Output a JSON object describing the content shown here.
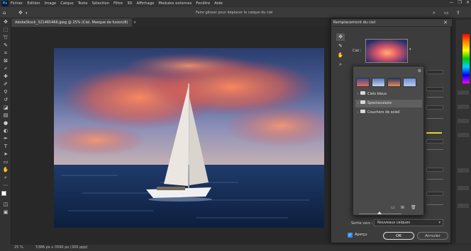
{
  "menubar": {
    "logo": "Ps",
    "items": [
      "Fichier",
      "Edition",
      "Image",
      "Calque",
      "Texte",
      "Sélection",
      "Filtre",
      "3D",
      "Affichage",
      "Modules externes",
      "Fenêtre",
      "Aide"
    ],
    "window_controls": [
      "—",
      "❐",
      "✕"
    ]
  },
  "optionsbar": {
    "hint": "Faire glisser pour déplacer le calque du ciel"
  },
  "document": {
    "tab_label": "AdobeStock_321465466.jpeg @ 25% (Ciel, Masque de fusion/8)",
    "tab_close": "×"
  },
  "statusbar": {
    "zoom": "25 %",
    "info": "5386 px x 3590 px (300 ppp)"
  },
  "dialog": {
    "title": "Remplacement du ciel",
    "close": "✕",
    "sky_label": "Ciel :",
    "dropdown_arrow": "▾",
    "output_label": "Sortie vers :",
    "output_value": "Nouveaux calques",
    "preview_check": "✓",
    "preview_label": "Aperçu",
    "ok_label": "OK",
    "cancel_label": "Annuler"
  },
  "sky_popup": {
    "gear": "⚙",
    "folders": [
      {
        "chevron": "›",
        "label": "Ciels bleus"
      },
      {
        "chevron": "›",
        "label": "Spectaculaire"
      },
      {
        "chevron": "›",
        "label": "Couchers de soleil"
      }
    ]
  },
  "colors": {
    "accent": "#3b8fe6",
    "dialog_bg": "#3c3c3c",
    "popup_bg": "#4a4a4a",
    "app_bg": "#282828"
  }
}
